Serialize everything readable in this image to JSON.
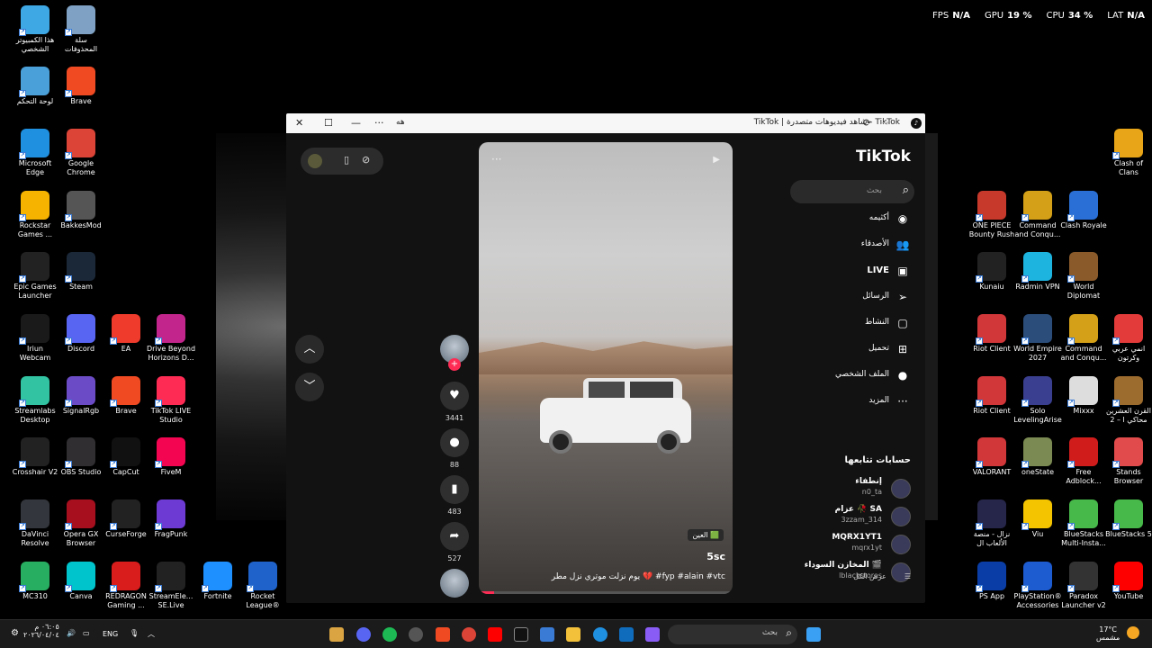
{
  "perf": {
    "fps_label": "FPS",
    "fps": "N/A",
    "gpu_label": "GPU",
    "gpu": "19 %",
    "cpu_label": "CPU",
    "cpu": "34 %",
    "lat_label": "LAT",
    "lat": "N/A"
  },
  "desktop_left": [
    {
      "label": "هذا الكمبيوتر\nالشخصي",
      "color": "#3ea8e5"
    },
    {
      "label": "سلة\nالمحذوفات",
      "color": "#7fa2c4"
    },
    {
      "label": "لوحة التحكم",
      "color": "#4aa0d8"
    },
    {
      "label": "Brave",
      "color": "#f04a23"
    },
    {
      "label": "Microsoft\nEdge",
      "color": "#1f8fdf"
    },
    {
      "label": "Google\nChrome",
      "color": "#db4437"
    },
    {
      "label": "Rockstar\nGames ...",
      "color": "#f6b300"
    },
    {
      "label": "BakkesMod",
      "color": "#555"
    },
    {
      "label": "Epic Games\nLauncher",
      "color": "#222"
    },
    {
      "label": "Steam",
      "color": "#1b2838"
    },
    {
      "label": "Iriun\nWebcam",
      "color": "#1a1a1a"
    },
    {
      "label": "Discord",
      "color": "#5865f2"
    },
    {
      "label": "EA",
      "color": "#ef3b2c"
    },
    {
      "label": "Drive Beyond\nHorizons D...",
      "color": "#c2268c"
    },
    {
      "label": "Streamlabs\nDesktop",
      "color": "#31c3a2"
    },
    {
      "label": "SignalRgb",
      "color": "#6c4cc6"
    },
    {
      "label": "Brave",
      "color": "#f04a23"
    },
    {
      "label": "TikTok LIVE\nStudio",
      "color": "#fe2c55"
    },
    {
      "label": "Crosshair V2",
      "color": "#222"
    },
    {
      "label": "OBS Studio",
      "color": "#302e31"
    },
    {
      "label": "CapCut",
      "color": "#111"
    },
    {
      "label": "FiveM",
      "color": "#f40552"
    },
    {
      "label": "DaVinci\nResolve",
      "color": "#33363c"
    },
    {
      "label": "Opera GX\nBrowser",
      "color": "#a70f1e"
    },
    {
      "label": "CurseForge",
      "color": "#222"
    },
    {
      "label": "FragPunk",
      "color": "#6d3bd4"
    },
    {
      "label": "MC310",
      "color": "#27ae60"
    },
    {
      "label": "Canva",
      "color": "#00c4cc"
    },
    {
      "label": "REDRAGON\nGaming ...",
      "color": "#d91c1c"
    },
    {
      "label": "StreamEle...\nSE.Live",
      "color": "#222"
    },
    {
      "label": "Fortnite",
      "color": "#1e90ff"
    },
    {
      "label": "Rocket\nLeague®",
      "color": "#1f62c9"
    }
  ],
  "desktop_right": [
    {
      "label": "Clash of\nClans",
      "color": "#e8a517"
    },
    {
      "label": "ONE PIECE\nBounty Rush",
      "color": "#c7392b"
    },
    {
      "label": "Command\nand Conqu...",
      "color": "#d4a017"
    },
    {
      "label": "Clash Royale",
      "color": "#2a6fd6"
    },
    {
      "label": "Kunaiu",
      "color": "#222"
    },
    {
      "label": "Radmin VPN",
      "color": "#1db4e0"
    },
    {
      "label": "World\nDiplomat",
      "color": "#8a5a2b"
    },
    {
      "label": "Riot Client",
      "color": "#d13639"
    },
    {
      "label": "World Empire\n2027",
      "color": "#2b4d7a"
    },
    {
      "label": "Command\nand Conqu...",
      "color": "#d4a017"
    },
    {
      "label": "انمي عربي\nوكرتون",
      "color": "#e33a3a"
    },
    {
      "label": "Riot Client",
      "color": "#d13639"
    },
    {
      "label": "Solo\nLevelingArise",
      "color": "#3a3f8f"
    },
    {
      "label": "Mixxx",
      "color": "#ddd"
    },
    {
      "label": "القرن العشرين\n2 – محاكي ا",
      "color": "#9c6b2e"
    },
    {
      "label": "VALORANT",
      "color": "#d13639"
    },
    {
      "label": "oneState",
      "color": "#7b8a52"
    },
    {
      "label": "Free\nAdblock...",
      "color": "#d11c1c"
    },
    {
      "label": "Stands\nBrowser",
      "color": "#e14b4b"
    },
    {
      "label": "نزال - منصة\nالألعاب ال",
      "color": "#26264a"
    },
    {
      "label": "Viu",
      "color": "#f5c400"
    },
    {
      "label": "BlueStacks\nMulti-Insta...",
      "color": "#47b84a"
    },
    {
      "label": "BlueStacks 5",
      "color": "#47b84a"
    },
    {
      "label": "PS App",
      "color": "#0a3ea6"
    },
    {
      "label": "PlayStation®\nAccessories",
      "color": "#1d5bd1"
    },
    {
      "label": "Paradox\nLauncher v2",
      "color": "#333"
    },
    {
      "label": "YouTube",
      "color": "#ff0000"
    }
  ],
  "window": {
    "title": "TikTok | شاهد فيديوهات متصدرة - TikTok",
    "ext_label": "ﻫﻪ"
  },
  "tiktok": {
    "logo": "TikTok",
    "search_placeholder": "بحث",
    "nav": [
      {
        "label": "أكثيمه",
        "icon": "foryou-icon"
      },
      {
        "label": "الأصدقاء",
        "icon": "friends-icon"
      },
      {
        "label": "LIVE",
        "icon": "live-icon"
      },
      {
        "label": "الرسائل",
        "icon": "messages-icon"
      },
      {
        "label": "النشاط",
        "icon": "activity-icon"
      },
      {
        "label": "تحميل",
        "icon": "upload-icon"
      },
      {
        "label": "الملف الشخصي",
        "icon": "profile-icon"
      },
      {
        "label": "المزيد",
        "icon": "more-icon"
      }
    ],
    "following_header": "حسابات تتابعها",
    "following": [
      {
        "name": "إنطفاء",
        "handle": "n0_ta"
      },
      {
        "name": "عزام 🥀 SA",
        "handle": "3zzam_314"
      },
      {
        "name": "MQRX1YT1",
        "handle": "mqrx1yt"
      },
      {
        "name": "المخازن السوداء 🎬",
        "handle": "lblackstores"
      }
    ],
    "see_all": "عرض الكل",
    "video": {
      "location_badge": "العين 🟩",
      "username": "5sc",
      "caption": "يوم نزلت موتري نزل مطر 💔 #fyp #alain #vtc",
      "progress": 0.06
    },
    "actions": {
      "likes": "3441",
      "comments": "88",
      "saves": "483",
      "shares": "527"
    }
  },
  "taskbar": {
    "search_placeholder": "بحث",
    "lang": "ENG",
    "time": "٠٦:٠٥ م",
    "date": "٢٠٢٦/٠٤/٠٤",
    "weather_temp": "17°C",
    "weather_desc": "مشمس"
  }
}
